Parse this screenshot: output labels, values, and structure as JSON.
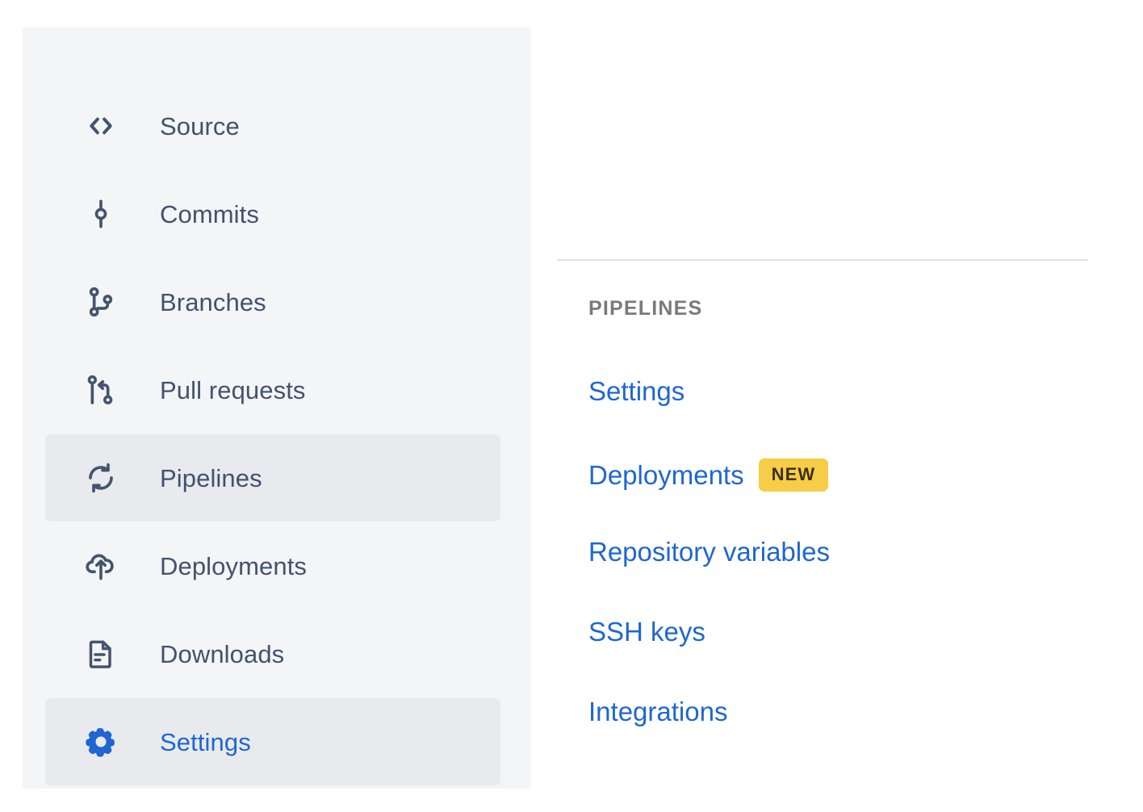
{
  "sidebar": {
    "background_color": "#f4f5f7",
    "active_background_color": "#e8eaee",
    "text_color": "#42526e",
    "active_text_color": "#1f66d2",
    "items": [
      {
        "label": "Source",
        "icon": "code-brackets-icon",
        "active": false
      },
      {
        "label": "Commits",
        "icon": "commit-icon",
        "active": false
      },
      {
        "label": "Branches",
        "icon": "branch-icon",
        "active": false
      },
      {
        "label": "Pull requests",
        "icon": "pull-request-icon",
        "active": false
      },
      {
        "label": "Pipelines",
        "icon": "sync-arrows-icon",
        "active": true
      },
      {
        "label": "Deployments",
        "icon": "cloud-upload-icon",
        "active": false
      },
      {
        "label": "Downloads",
        "icon": "document-icon",
        "active": false
      },
      {
        "label": "Settings",
        "icon": "gear-icon",
        "active": true
      }
    ]
  },
  "panel": {
    "heading": "PIPELINES",
    "heading_color": "#7a7a7a",
    "link_color": "#1f66d2",
    "divider_color": "#dfe1e6",
    "links": [
      {
        "label": "Settings",
        "badge": null
      },
      {
        "label": "Deployments",
        "badge": "NEW"
      },
      {
        "label": "Repository variables",
        "badge": null
      },
      {
        "label": "SSH keys",
        "badge": null
      },
      {
        "label": "Integrations",
        "badge": null
      }
    ],
    "badge": {
      "text": "NEW",
      "background_color": "#f5cd47",
      "text_color": "#3d3012"
    }
  }
}
